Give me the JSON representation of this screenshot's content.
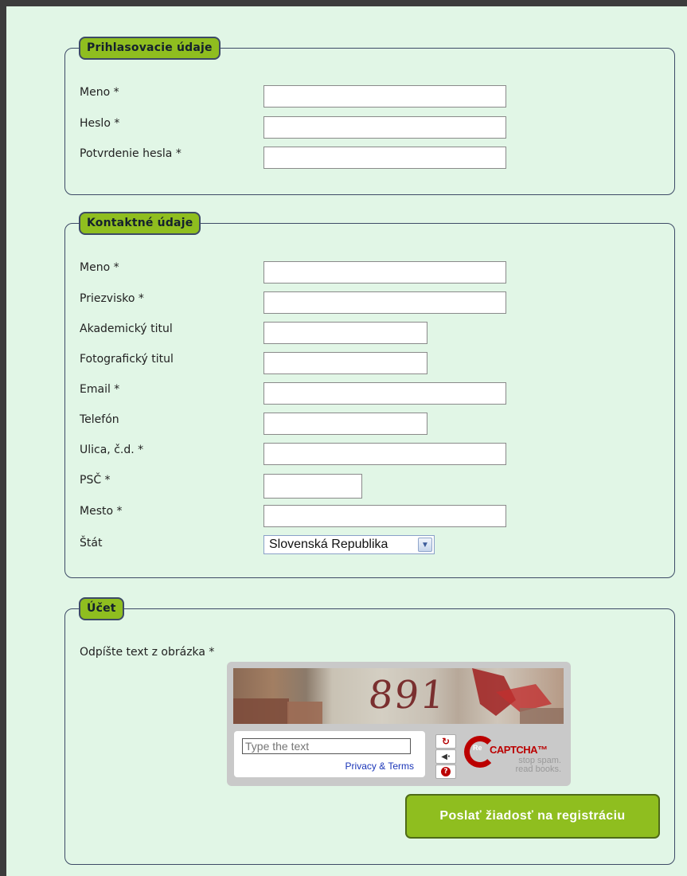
{
  "sections": {
    "login": {
      "legend": "Prihlasovacie údaje",
      "fields": [
        {
          "label": "Meno *"
        },
        {
          "label": "Heslo *"
        },
        {
          "label": "Potvrdenie hesla *"
        }
      ]
    },
    "contact": {
      "legend": "Kontaktné údaje",
      "fields": [
        {
          "label": "Meno *"
        },
        {
          "label": "Priezvisko *"
        },
        {
          "label": "Akademický titul"
        },
        {
          "label": "Fotografický titul"
        },
        {
          "label": "Email *"
        },
        {
          "label": "Telefón"
        },
        {
          "label": "Ulica, č.d. *"
        },
        {
          "label": "PSČ *"
        },
        {
          "label": "Mesto *"
        },
        {
          "label": "Štát"
        }
      ],
      "country_selected": "Slovenská Republika"
    },
    "account": {
      "legend": "Účet",
      "captcha_label": "Odpíšte text z obrázka *"
    }
  },
  "captcha": {
    "image_text": "891",
    "input_placeholder": "Type the text",
    "privacy_link": "Privacy & Terms",
    "logo_re": "Re",
    "logo_name": "CAPTCHA™",
    "logo_tag_1": "stop spam.",
    "logo_tag_2": "read books.",
    "buttons": [
      "refresh-icon",
      "audio-icon",
      "help-icon"
    ]
  },
  "submit_label": "Poslať žiadosť na registráciu",
  "colors": {
    "background": "#e1f6e6",
    "accent": "#8fbe1f",
    "border": "#3d4a66"
  }
}
